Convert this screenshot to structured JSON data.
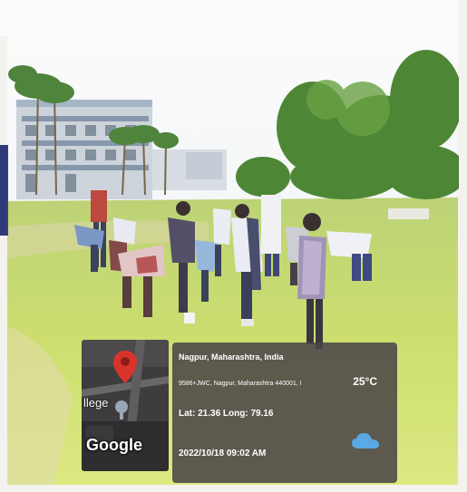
{
  "location": {
    "place": "Nagpur, Maharashtra, India",
    "address": "9586+JWC, Nagpur, Maharashtra 440001, I",
    "latlng": "Lat: 21.36 Long: 79.16",
    "datetime": "2022/10/18 09:02 AM",
    "temperature": "25°C",
    "weather_icon": "cloud-icon"
  },
  "map": {
    "label": "llege",
    "brand": "Google",
    "pin_icon": "map-pin-icon"
  }
}
